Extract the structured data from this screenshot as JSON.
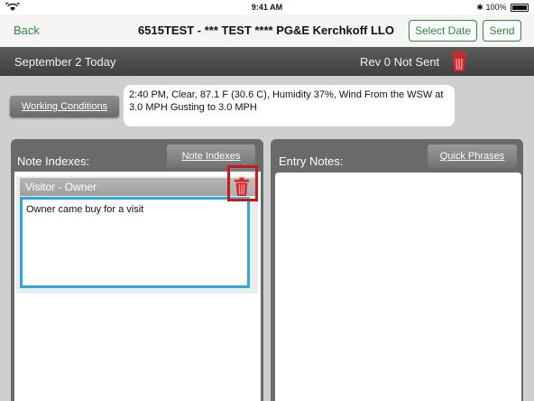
{
  "status_bar": {
    "time": "9:41 AM",
    "battery": "100%"
  },
  "nav": {
    "back": "Back",
    "title": "6515TEST - *** TEST **** PG&E Kerchkoff LLO",
    "select_date": "Select Date",
    "send": "Send"
  },
  "date_bar": {
    "date": "September 2 Today",
    "revision": "Rev 0 Not Sent"
  },
  "working_conditions": {
    "button": "Working Conditions",
    "text": "2:40 PM, Clear, 87.1 F (30.6 C), Humidity 37%, Wind From the WSW at 3.0 MPH Gusting to 3.0 MPH"
  },
  "note_indexes": {
    "title": "Note Indexes:",
    "button": "Note Indexes",
    "items": [
      {
        "header": "Visitor - Owner",
        "text": "Owner came buy for a visit"
      }
    ]
  },
  "entry_notes": {
    "title": "Entry Notes:",
    "button": "Quick Phrases"
  },
  "colors": {
    "accent_green": "#2d8a3c",
    "trash_red": "#d9262b",
    "selection_blue": "#29a9dc",
    "highlight_red": "#c21b1b"
  },
  "icons": [
    "wifi-icon",
    "bluetooth-icon",
    "battery-icon",
    "trash-icon"
  ]
}
